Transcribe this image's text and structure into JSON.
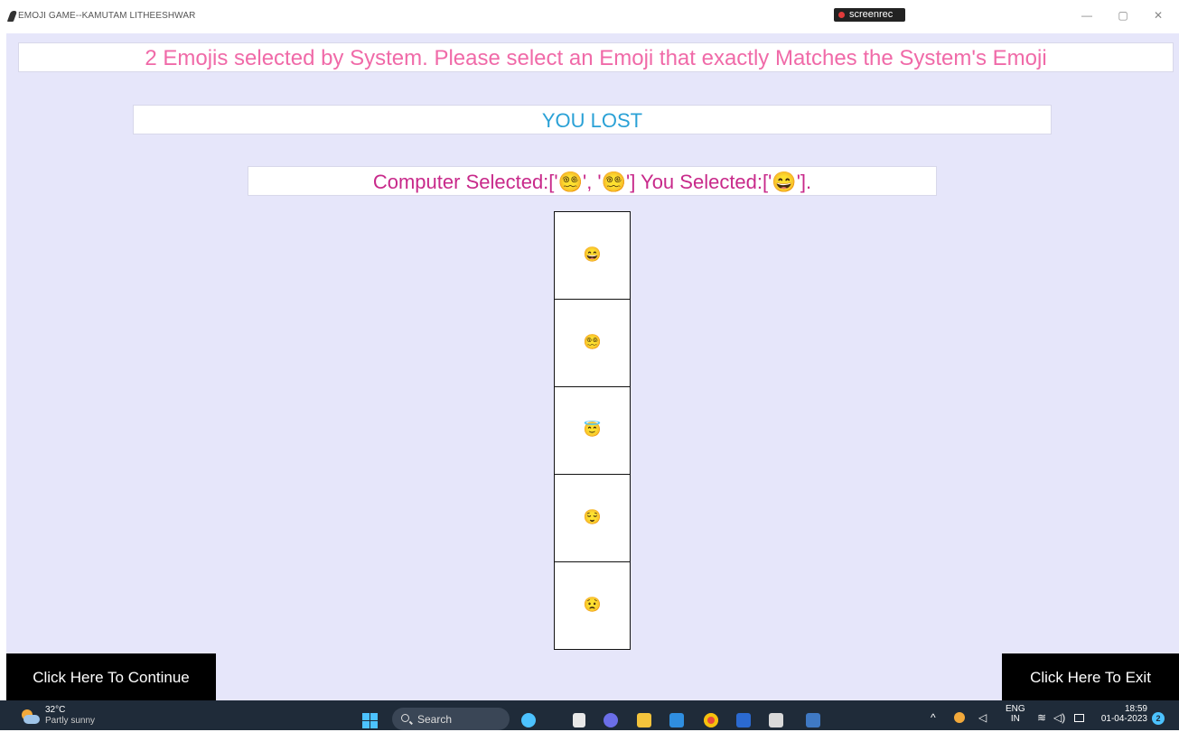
{
  "window": {
    "title": "EMOJI GAME--KAMUTAM LITHEESHWAR",
    "recorder_label": "screenrec",
    "controls": {
      "minimize": "—",
      "maximize": "▢",
      "close": "✕"
    }
  },
  "game": {
    "prompt": "2 Emojis selected by System. Please select an Emoji that exactly Matches the System's Emoji",
    "result": "YOU LOST",
    "detail": "Computer Selected:['😵‍💫', '😵‍💫'] You Selected:['😄'].",
    "emoji_buttons": [
      {
        "label": "😄",
        "name": "grinning-face"
      },
      {
        "label": "😵‍💫",
        "name": "dizzy-face"
      },
      {
        "label": "😇",
        "name": "halo-face"
      },
      {
        "label": "😌",
        "name": "relieved-face"
      },
      {
        "label": "😟",
        "name": "worried-face"
      }
    ],
    "continue_label": "Click Here To Continue",
    "exit_label": "Click Here To Exit"
  },
  "taskbar": {
    "weather_temp": "32°C",
    "weather_condition": "Partly sunny",
    "search_placeholder": "Search",
    "tray_chevron": "^",
    "language_line1": "ENG",
    "language_line2": "IN",
    "time": "18:59",
    "date": "01-04-2023",
    "notification_count": "2"
  },
  "colors": {
    "app_background": "#e6e6fa",
    "prompt_text": "#f06aa8",
    "result_text": "#2aa1d6",
    "detail_text": "#c8298a",
    "taskbar": "#1f2b39"
  }
}
